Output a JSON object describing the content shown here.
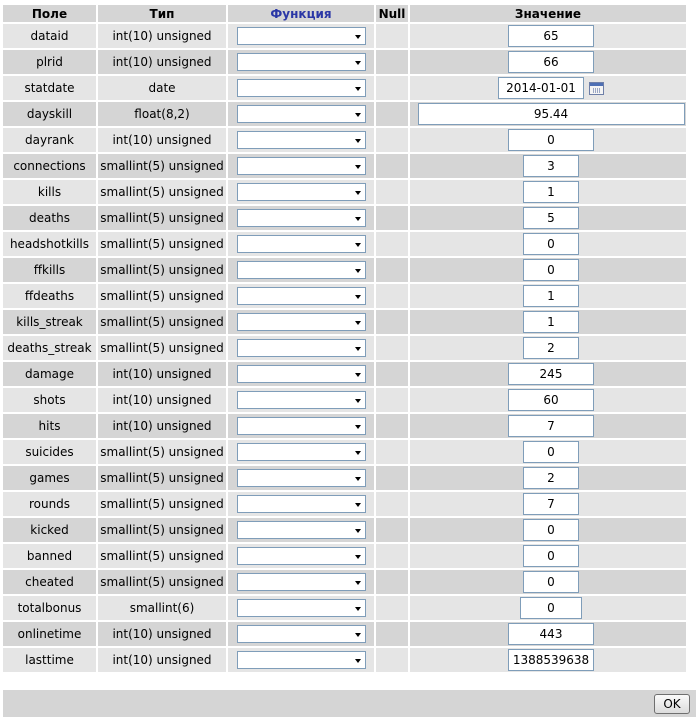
{
  "headers": {
    "name": "Поле",
    "type": "Тип",
    "function": "Функция",
    "null": "Null",
    "value": "Значение"
  },
  "rows": [
    {
      "name": "dataid",
      "type": "int(10) unsigned",
      "value": "65"
    },
    {
      "name": "plrid",
      "type": "int(10) unsigned",
      "value": "66"
    },
    {
      "name": "statdate",
      "type": "date",
      "value": "2014-01-01"
    },
    {
      "name": "dayskill",
      "type": "float(8,2)",
      "value": "95.44"
    },
    {
      "name": "dayrank",
      "type": "int(10) unsigned",
      "value": "0"
    },
    {
      "name": "connections",
      "type": "smallint(5) unsigned",
      "value": "3"
    },
    {
      "name": "kills",
      "type": "smallint(5) unsigned",
      "value": "1"
    },
    {
      "name": "deaths",
      "type": "smallint(5) unsigned",
      "value": "5"
    },
    {
      "name": "headshotkills",
      "type": "smallint(5) unsigned",
      "value": "0"
    },
    {
      "name": "ffkills",
      "type": "smallint(5) unsigned",
      "value": "0"
    },
    {
      "name": "ffdeaths",
      "type": "smallint(5) unsigned",
      "value": "1"
    },
    {
      "name": "kills_streak",
      "type": "smallint(5) unsigned",
      "value": "1"
    },
    {
      "name": "deaths_streak",
      "type": "smallint(5) unsigned",
      "value": "2"
    },
    {
      "name": "damage",
      "type": "int(10) unsigned",
      "value": "245"
    },
    {
      "name": "shots",
      "type": "int(10) unsigned",
      "value": "60"
    },
    {
      "name": "hits",
      "type": "int(10) unsigned",
      "value": "7"
    },
    {
      "name": "suicides",
      "type": "smallint(5) unsigned",
      "value": "0"
    },
    {
      "name": "games",
      "type": "smallint(5) unsigned",
      "value": "2"
    },
    {
      "name": "rounds",
      "type": "smallint(5) unsigned",
      "value": "7"
    },
    {
      "name": "kicked",
      "type": "smallint(5) unsigned",
      "value": "0"
    },
    {
      "name": "banned",
      "type": "smallint(5) unsigned",
      "value": "0"
    },
    {
      "name": "cheated",
      "type": "smallint(5) unsigned",
      "value": "0"
    },
    {
      "name": "totalbonus",
      "type": "smallint(6)",
      "value": "0"
    },
    {
      "name": "onlinetime",
      "type": "int(10) unsigned",
      "value": "443"
    },
    {
      "name": "lasttime",
      "type": "int(10) unsigned",
      "value": "1388539638"
    }
  ],
  "ok_label": "OK"
}
